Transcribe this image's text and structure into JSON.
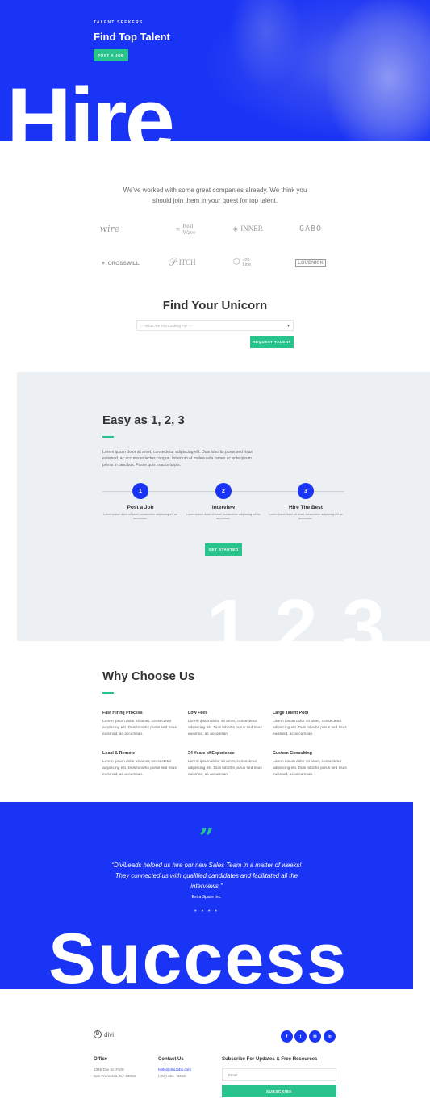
{
  "hero": {
    "eyebrow": "TALENT SEEKERS",
    "title": "Find Top Talent",
    "button": "POST A JOB",
    "big_word": "Hire"
  },
  "clients": {
    "text": "We've worked with some great companies already. We think you should join them in your quest for top talent.",
    "logos": [
      {
        "name": "wire",
        "text": "wire"
      },
      {
        "name": "realwave",
        "text1": "Real",
        "text2": "Wave"
      },
      {
        "name": "inner",
        "text": "INNER"
      },
      {
        "name": "gabo",
        "text": "GABO"
      },
      {
        "name": "crosswill",
        "text": "CROSSWILL"
      },
      {
        "name": "pitch",
        "text": "ITCH"
      },
      {
        "name": "jobline",
        "text1": "Job",
        "text2": "Line"
      },
      {
        "name": "loudnick",
        "text": "LOUDNICK"
      }
    ]
  },
  "unicorn": {
    "title": "Find Your Unicorn",
    "select_placeholder": "--- What Are You Looking For ---",
    "button": "REQUEST TALENT"
  },
  "steps": {
    "title": "Easy as 1, 2, 3",
    "body": "Lorem ipsum dolor sit amet, consectetur adipiscing elit. Duis lobortis purus sed risus euismod, ac accumsan lectus congue. Interdum et malesuada fames ac ante ipsum primis in faucibus. Fusce quis mauris turpis.",
    "items": [
      {
        "num": "1",
        "title": "Post a Job",
        "text": "Lorem ipsum dolor sit amet, consectetur adipiscing elit ac accumsan."
      },
      {
        "num": "2",
        "title": "Interview",
        "text": "Lorem ipsum dolor sit amet, consectetur adipiscing elit ac accumsan."
      },
      {
        "num": "3",
        "title": "Hire The Best",
        "text": "Lorem ipsum dolor sit amet, consectetur adipiscing elit ac accumsan."
      }
    ],
    "button": "GET STARTED",
    "big_text": "1.2.3."
  },
  "why": {
    "title": "Why Choose Us",
    "features": [
      {
        "title": "Fast Hiring Process",
        "text": "Lorem ipsum dolor sit amet, consectetur adipiscing elit. Duis lobortis purus sed risus euismod, ac accumsan."
      },
      {
        "title": "Low Fees",
        "text": "Lorem ipsum dolor sit amet, consectetur adipiscing elit. Duis lobortis purus sed risus euismod, ac accumsan."
      },
      {
        "title": "Large Talent Pool",
        "text": "Lorem ipsum dolor sit amet, consectetur adipiscing elit. Duis lobortis purus sed risus euismod, ac accumsan."
      },
      {
        "title": "Local & Remote",
        "text": "Lorem ipsum dolor sit amet, consectetur adipiscing elit. Duis lobortis purus sed risus euismod, ac accumsan."
      },
      {
        "title": "24 Years of Experience",
        "text": "Lorem ipsum dolor sit amet, consectetur adipiscing elit. Duis lobortis purus sed risus euismod, ac accumsan."
      },
      {
        "title": "Custom Consulting",
        "text": "Lorem ipsum dolor sit amet, consectetur adipiscing elit. Duis lobortis purus sed risus euismod, ac accumsan."
      }
    ]
  },
  "testimonial": {
    "quote_mark": "”",
    "text": "“DiviLeads helped us hire our new Sales Team in a matter of weeks! They connected us with qualified candidates and facilitated all the interviews.”",
    "author": "Extra Space Inc.",
    "dots": "• • • •",
    "big_word": "Success"
  },
  "footer": {
    "brand_letter": "D",
    "brand": "divi",
    "social": [
      "f",
      "t",
      "✉",
      "in"
    ],
    "office_title": "Office",
    "office_line1": "2345 Divi St. #100",
    "office_line2": "San Francisco, CA 93856",
    "contact_title": "Contact Us",
    "contact_email": "hello@diviJobs.com",
    "contact_phone": "(450) 321 - 3455",
    "subscribe_title": "Subscribe For Updates & Free Resources",
    "email_placeholder": "Email",
    "subscribe_button": "SUBSCRIBE"
  },
  "colors": {
    "blue": "#1a34f5",
    "green": "#29c48b",
    "panel": "#edf0f3"
  }
}
